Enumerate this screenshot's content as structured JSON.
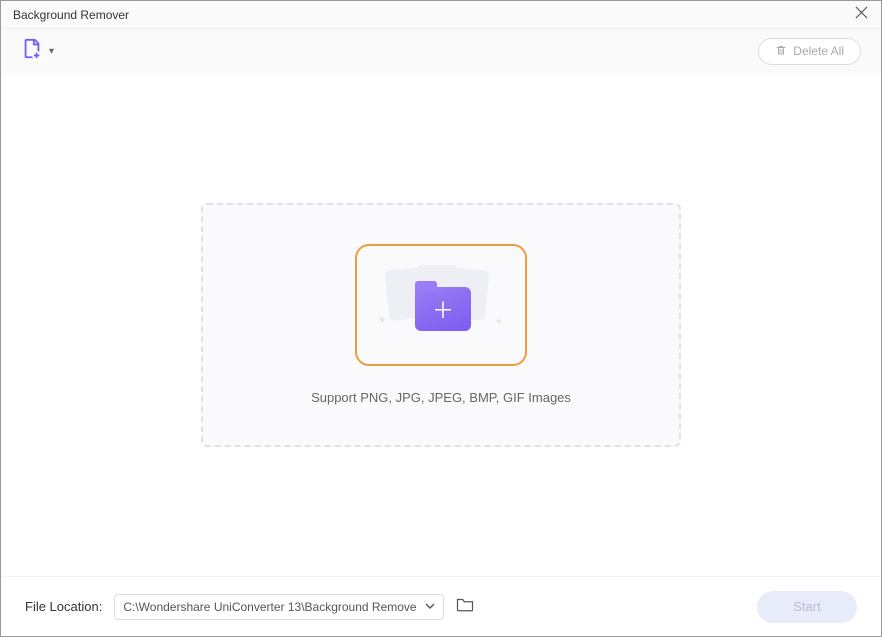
{
  "window": {
    "title": "Background Remover"
  },
  "toolbar": {
    "delete_all_label": "Delete All"
  },
  "dropzone": {
    "support_text": "Support PNG, JPG, JPEG, BMP, GIF Images"
  },
  "footer": {
    "location_label": "File Location:",
    "location_path": "C:\\Wondershare UniConverter 13\\Background Remove",
    "start_label": "Start"
  },
  "colors": {
    "accent_purple": "#7b5cf0",
    "accent_orange": "#ef9b3f"
  }
}
